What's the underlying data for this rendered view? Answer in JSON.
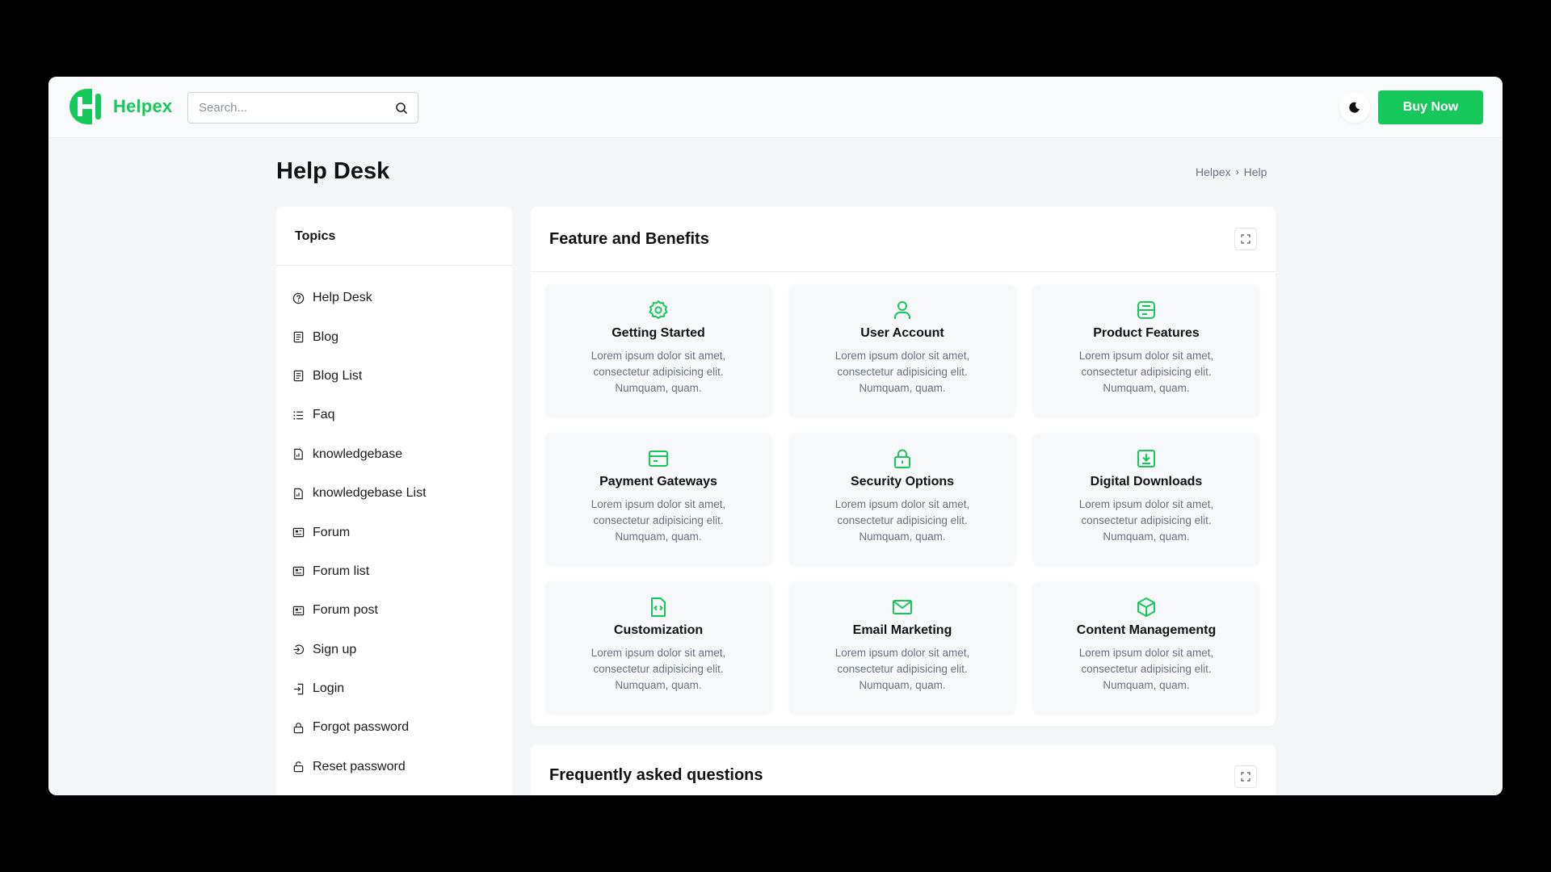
{
  "brand": {
    "name": "Helpex",
    "accent": "#16c75a"
  },
  "search": {
    "placeholder": "Search..."
  },
  "header": {
    "buy_label": "Buy Now",
    "theme_icon": "moon-icon"
  },
  "page": {
    "title": "Help Desk"
  },
  "breadcrumb": {
    "items": [
      "Helpex",
      "Help"
    ]
  },
  "sidebar": {
    "title": "Topics",
    "items": [
      {
        "label": "Help Desk",
        "icon": "help-circle-icon"
      },
      {
        "label": "Blog",
        "icon": "document-icon"
      },
      {
        "label": "Blog List",
        "icon": "document-icon"
      },
      {
        "label": "Faq",
        "icon": "list-icon"
      },
      {
        "label": "knowledgebase",
        "icon": "file-chart-icon"
      },
      {
        "label": "knowledgebase List",
        "icon": "file-chart-icon"
      },
      {
        "label": "Forum",
        "icon": "newspaper-icon"
      },
      {
        "label": "Forum list",
        "icon": "newspaper-icon"
      },
      {
        "label": "Forum post",
        "icon": "newspaper-icon"
      },
      {
        "label": "Sign up",
        "icon": "sign-in-icon"
      },
      {
        "label": "Login",
        "icon": "login-icon"
      },
      {
        "label": "Forgot password",
        "icon": "lock-icon"
      },
      {
        "label": "Reset password",
        "icon": "lock-open-icon"
      }
    ]
  },
  "features": {
    "title": "Feature and Benefits",
    "cards": [
      {
        "title": "Getting Started",
        "text": "Lorem ipsum dolor sit amet, consectetur adipisicing elit. Numquam, quam.",
        "icon": "settings-icon"
      },
      {
        "title": "User Account",
        "text": "Lorem ipsum dolor sit amet, consectetur adipisicing elit. Numquam, quam.",
        "icon": "user-icon"
      },
      {
        "title": "Product Features",
        "text": "Lorem ipsum dolor sit amet, consectetur adipisicing elit. Numquam, quam.",
        "icon": "layout-icon"
      },
      {
        "title": "Payment Gateways",
        "text": "Lorem ipsum dolor sit amet, consectetur adipisicing elit. Numquam, quam.",
        "icon": "credit-card-icon"
      },
      {
        "title": "Security Options",
        "text": "Lorem ipsum dolor sit amet, consectetur adipisicing elit. Numquam, quam.",
        "icon": "lock-icon"
      },
      {
        "title": "Digital Downloads",
        "text": "Lorem ipsum dolor sit amet, consectetur adipisicing elit. Numquam, quam.",
        "icon": "download-icon"
      },
      {
        "title": "Customization",
        "text": "Lorem ipsum dolor sit amet, consectetur adipisicing elit. Numquam, quam.",
        "icon": "file-code-icon"
      },
      {
        "title": "Email Marketing",
        "text": "Lorem ipsum dolor sit amet, consectetur adipisicing elit. Numquam, quam.",
        "icon": "mail-icon"
      },
      {
        "title": "Content Managementg",
        "text": "Lorem ipsum dolor sit amet, consectetur adipisicing elit. Numquam, quam.",
        "icon": "cube-icon"
      }
    ]
  },
  "faq": {
    "title": "Frequently asked questions"
  }
}
